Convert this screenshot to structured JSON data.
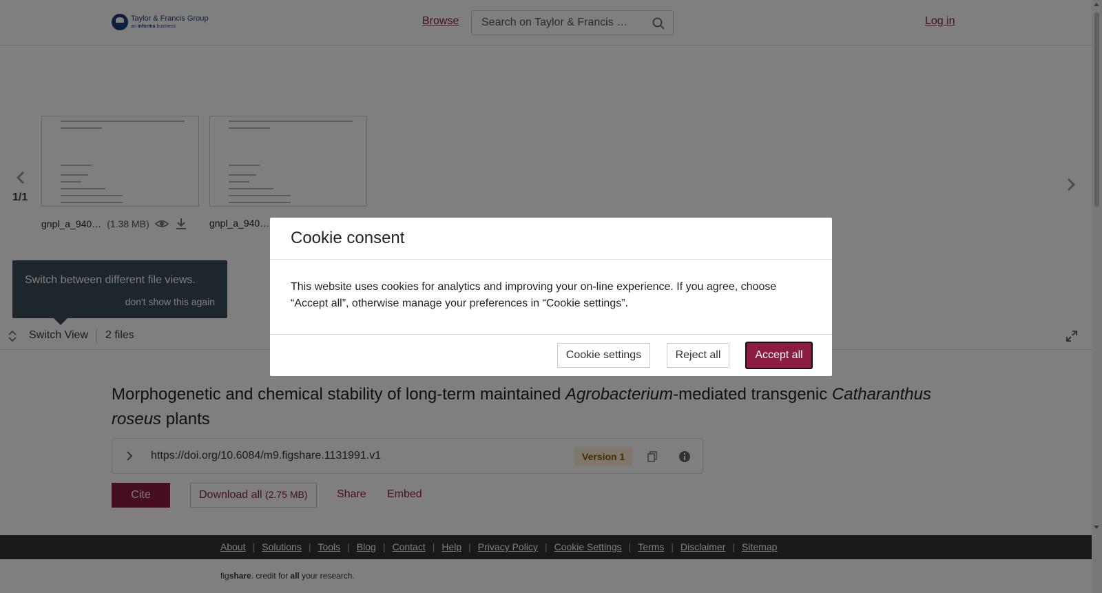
{
  "header": {
    "logo_main": "Taylor & Francis Group",
    "logo_sub_prefix": "an ",
    "logo_sub_bold": "informa",
    "logo_sub_suffix": " business",
    "browse": "Browse",
    "search_placeholder": "Search on Taylor & Francis …",
    "login": "Log in"
  },
  "preview": {
    "counter": "1/1",
    "files": [
      {
        "name": "gnpl_a_940…",
        "size": "(1.38 MB)"
      },
      {
        "name": "gnpl_a_940…",
        "size": ""
      }
    ],
    "tooltip_text": "Switch between different file views.",
    "tooltip_dismiss": "don't show this again",
    "switch_view": "Switch View",
    "files_count": "2 files"
  },
  "article": {
    "title_part1": "Morphogenetic and chemical stability of long-term maintained ",
    "title_italic1": "Agrobacterium",
    "title_part2": "-mediated transgenic ",
    "title_italic2": "Catharanthus roseus",
    "title_part3": " plants",
    "doi": "https://doi.org/10.6084/m9.figshare.1131991.v1",
    "version": "Version 1",
    "cite": "Cite",
    "download_all": "Download all",
    "download_size": "(2.75 MB)",
    "share": "Share",
    "embed": "Embed"
  },
  "footer": {
    "links": [
      "About",
      "Solutions",
      "Tools",
      "Blog",
      "Contact",
      "Help",
      "Privacy Policy",
      "Cookie Settings",
      "Terms",
      "Disclaimer",
      "Sitemap"
    ],
    "credit_pre": "fig",
    "credit_bold": "share",
    "credit_mid": ". credit for ",
    "credit_all": "all",
    "credit_end": " your research."
  },
  "modal": {
    "title": "Cookie consent",
    "body": "This website uses cookies for analytics and improving your on-line experience. If you agree, choose “Accept all”, otherwise manage your preferences in “Cookie settings”.",
    "settings": "Cookie settings",
    "reject": "Reject all",
    "accept": "Accept all"
  },
  "colors": {
    "accent": "#8c1d40",
    "footer_bg": "#333333",
    "tooltip_bg": "#3a4a5a"
  }
}
